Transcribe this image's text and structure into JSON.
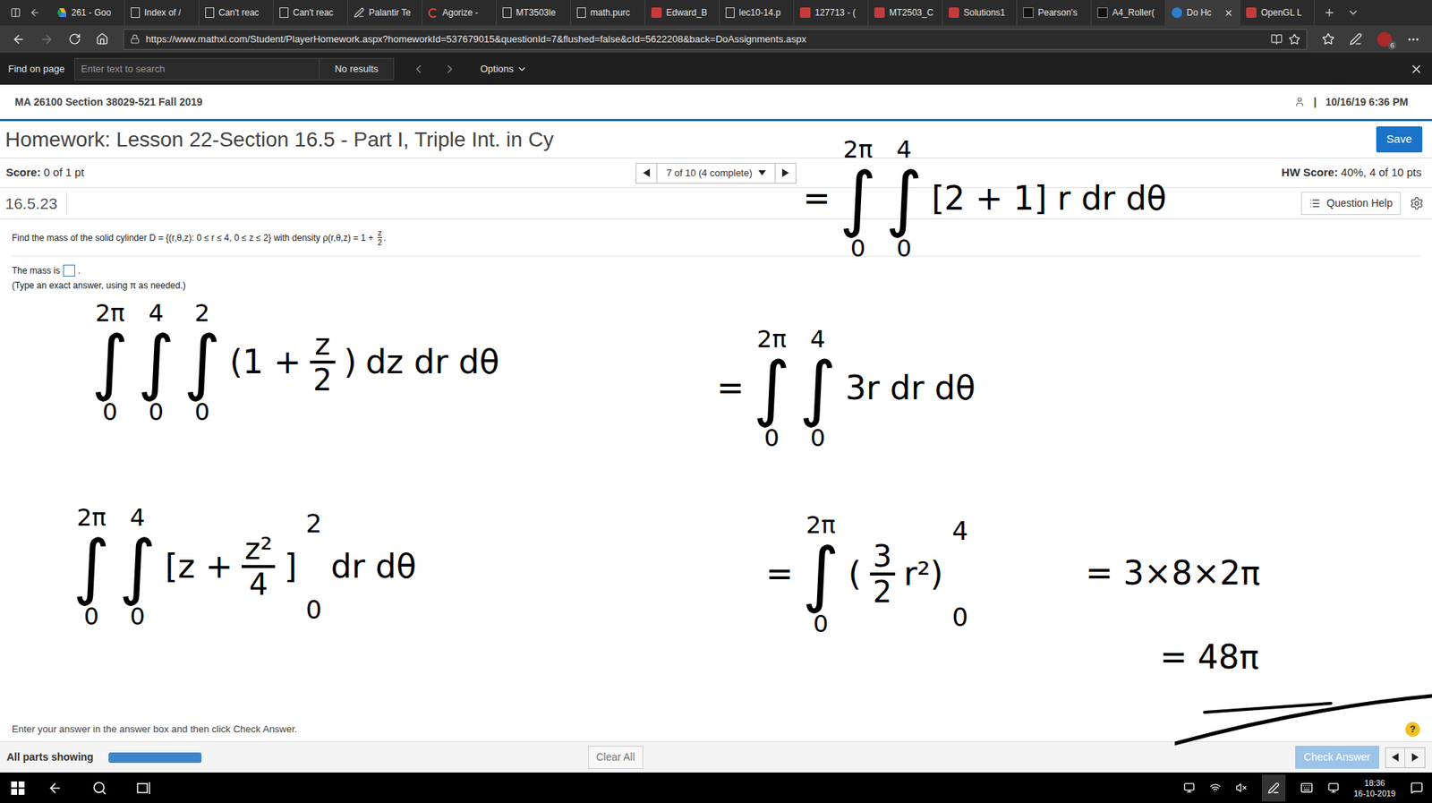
{
  "browser": {
    "tabs": [
      {
        "label": "261 - Goo",
        "selected": false,
        "kind": "drive"
      },
      {
        "label": "Index of /",
        "selected": false,
        "kind": "page"
      },
      {
        "label": "Can't reac",
        "selected": false,
        "kind": "page"
      },
      {
        "label": "Can't reac",
        "selected": false,
        "kind": "page"
      },
      {
        "label": "Palantir Te",
        "selected": false,
        "kind": "edit"
      },
      {
        "label": "Agorize -",
        "selected": false,
        "kind": "agorize"
      },
      {
        "label": "MT3503le",
        "selected": false,
        "kind": "page"
      },
      {
        "label": "math.purc",
        "selected": false,
        "kind": "page"
      },
      {
        "label": "Edward_B",
        "selected": false,
        "kind": "pdf"
      },
      {
        "label": "lec10-14.p",
        "selected": false,
        "kind": "page"
      },
      {
        "label": "127713 - (",
        "selected": false,
        "kind": "pdf"
      },
      {
        "label": "MT2503_C",
        "selected": false,
        "kind": "pdf"
      },
      {
        "label": "Solutions1",
        "selected": false,
        "kind": "pdf"
      },
      {
        "label": "Pearson's",
        "selected": false,
        "kind": "bb"
      },
      {
        "label": "A4_Roller(",
        "selected": false,
        "kind": "bb"
      },
      {
        "label": "Do Hc",
        "selected": true,
        "kind": "pearson"
      },
      {
        "label": "OpenGL L",
        "selected": false,
        "kind": "pdf"
      }
    ],
    "url": "https://www.mathxl.com/Student/PlayerHomework.aspx?homeworkId=537679015&questionId=7&flushed=false&cId=5622208&back=DoAssignments.aspx",
    "profile_badge": "6",
    "find_bar": {
      "label": "Find on page",
      "placeholder": "Enter text to search",
      "result": "No results",
      "options": "Options"
    }
  },
  "page": {
    "course": "MA 26100 Section 38029-521 Fall 2019",
    "separator": "|",
    "timestamp": "10/16/19 6:36 PM",
    "title": "Homework: Lesson 22-Section 16.5 - Part I, Triple Int. in Cy",
    "save": "Save",
    "score_label": "Score:",
    "score_value": "0 of 1 pt",
    "nav": "7 of 10 (4 complete)",
    "hw_score_label": "HW Score:",
    "hw_score_value": "40%, 4 of 10 pts",
    "question_id": "16.5.23",
    "question_help": "Question Help",
    "question": {
      "before": "Find the mass of the solid cylinder D = {(r,θ,z): 0 ≤ r ≤ 4, 0 ≤ z ≤ 2} with density ρ(r,θ,z) = 1 + ",
      "num": "z",
      "den": "2",
      "after": "."
    },
    "answer_label": "The mass is",
    "answer_after": ".",
    "answer_value": "",
    "hint": "(Type an exact answer, using π as needed.)",
    "footer_hint": "Enter your answer in the answer box and then click Check Answer.",
    "help_badge": "?",
    "all_parts": "All parts showing",
    "progress": {
      "level": 1
    },
    "clear_all": "Clear All",
    "check_answer": "Check Answer"
  },
  "ink": [
    {
      "tokens": [
        {
          "kind": "int",
          "sign": "∫",
          "upper": "2π",
          "lower": "0"
        },
        {
          "kind": "int",
          "sign": "∫",
          "upper": "4",
          "lower": "0"
        },
        {
          "kind": "int",
          "sign": "∫",
          "upper": "2",
          "lower": "0"
        },
        {
          "kind": "text",
          "text": "(1 +"
        },
        {
          "kind": "frac",
          "num": "z",
          "den": "2"
        },
        {
          "kind": "text",
          "text": ")"
        },
        {
          "kind": "text",
          "text": "dz dr dθ"
        }
      ]
    },
    {
      "tokens": [
        {
          "kind": "int",
          "sign": "∫",
          "upper": "2π",
          "lower": "0"
        },
        {
          "kind": "int",
          "sign": "∫",
          "upper": "4",
          "lower": "0"
        },
        {
          "kind": "text",
          "text": "[z +"
        },
        {
          "kind": "frac",
          "num": "z²",
          "den": "4"
        },
        {
          "kind": "text",
          "text": "]"
        },
        {
          "kind": "limits",
          "upper": "2",
          "lower": "0"
        },
        {
          "kind": "text",
          "text": "dr dθ"
        }
      ]
    },
    {
      "tokens": [
        {
          "kind": "text",
          "text": "="
        },
        {
          "kind": "int",
          "sign": "∫",
          "upper": "2π",
          "lower": "0"
        },
        {
          "kind": "int",
          "sign": "∫",
          "upper": "4",
          "lower": "0"
        },
        {
          "kind": "text",
          "text": "[2 + 1] r dr dθ"
        }
      ]
    },
    {
      "tokens": [
        {
          "kind": "text",
          "text": "="
        },
        {
          "kind": "int",
          "sign": "∫",
          "upper": "2π",
          "lower": "0"
        },
        {
          "kind": "int",
          "sign": "∫",
          "upper": "4",
          "lower": "0"
        },
        {
          "kind": "text",
          "text": "3r dr dθ"
        }
      ]
    },
    {
      "tokens": [
        {
          "kind": "text",
          "text": "="
        },
        {
          "kind": "int",
          "sign": "∫",
          "upper": "2π",
          "lower": "0"
        },
        {
          "kind": "text",
          "text": "("
        },
        {
          "kind": "frac",
          "num": "3",
          "den": "2"
        },
        {
          "kind": "text",
          "text": "r²)"
        },
        {
          "kind": "limits",
          "upper": "4",
          "lower": "0"
        }
      ]
    },
    {
      "tokens": [
        {
          "kind": "text",
          "text": "= 3×8×2π"
        }
      ]
    },
    {
      "tokens": [
        {
          "kind": "text",
          "text": "= 48π"
        }
      ]
    }
  ],
  "taskbar": {
    "time": "18:36",
    "date": "16-10-2019"
  }
}
